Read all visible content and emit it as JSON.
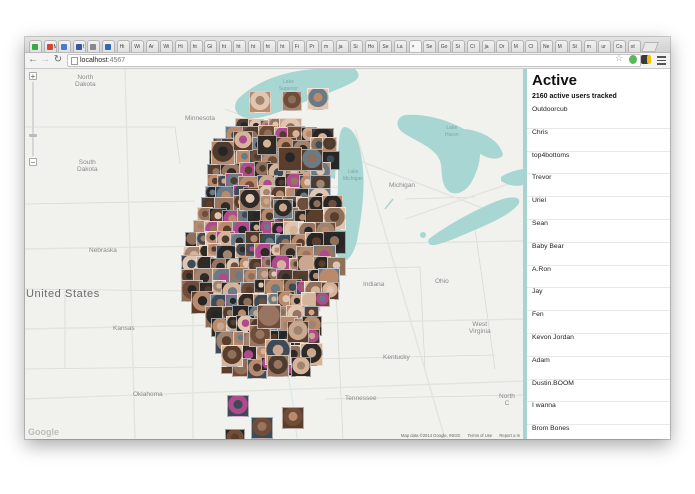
{
  "browser": {
    "url_host": "localhost",
    "url_port": ":4567",
    "tabs": [
      "",
      "M",
      "",
      "f",
      "",
      "",
      "Hi",
      "Wi",
      "Ar",
      "Wi",
      "Hi",
      "ht",
      "Gi",
      "ht",
      "ht",
      "ht",
      "ht",
      "ht",
      "Fi",
      "Pr",
      "m",
      "ja",
      "Si",
      "Ho",
      "Se",
      "La",
      "×",
      "Se",
      "Go",
      "Si",
      "Cl",
      "ja",
      "Dr",
      "M",
      "Cl",
      "Ne",
      "M",
      "St",
      "m",
      "ur",
      "Co",
      "ot"
    ]
  },
  "map": {
    "labels": {
      "north_dakota": "North\nDakota",
      "minnesota": "Minnesota",
      "south_dakota": "South\nDakota",
      "nebraska": "Nebraska",
      "united_states": "United States",
      "kansas": "Kansas",
      "oklahoma": "Oklahoma",
      "michigan": "Michigan",
      "indiana": "Indiana",
      "ohio": "Ohio",
      "west_virginia": "West\nVirginia",
      "kentucky": "Kentucky",
      "tennessee": "Tennessee",
      "north_carolina": "North\nC",
      "lake_superior": "Lake\nSuperior",
      "lake_michigan": "Lake\nMichigan",
      "lake_huron": "Lake\nHuron"
    },
    "zoom_in": "+",
    "zoom_out": "−",
    "logo": "Google",
    "attribution": {
      "data": "Map data ©2014 Google, INEGI",
      "terms": "Terms of Use",
      "report": "Report a m"
    }
  },
  "sidebar": {
    "title": "Active",
    "count_text": "2160 active users tracked",
    "users": [
      "Outdoorcub",
      "Chris",
      "top4bottoms",
      "Trevor",
      "Uriel",
      "Sean",
      "Baby Bear",
      "A.Ron",
      "Jay",
      "Fen",
      "Kevon Jordan",
      "Adam",
      "Dustin.BOOM",
      "I wanna",
      "Brom Bones"
    ]
  },
  "colors": {
    "water": "#a8d6d2",
    "land": "#f1f1ee",
    "sidebar_accent": "#a9d3cf"
  }
}
